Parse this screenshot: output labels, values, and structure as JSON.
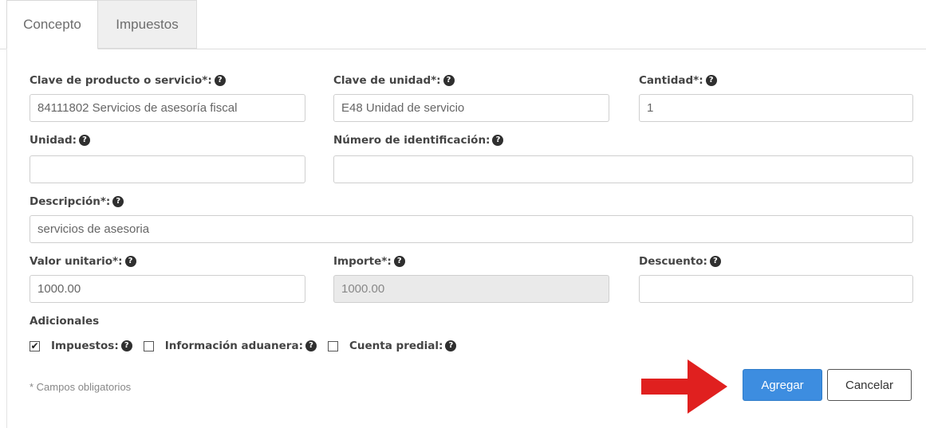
{
  "tabs": [
    {
      "label": "Concepto",
      "active": true
    },
    {
      "label": "Impuestos",
      "active": false
    }
  ],
  "fields": {
    "clave_producto": {
      "label": "Clave de producto o servicio*:",
      "value": "84111802 Servicios de asesoría fiscal"
    },
    "clave_unidad": {
      "label": "Clave de unidad*:",
      "value": "E48 Unidad de servicio"
    },
    "cantidad": {
      "label": "Cantidad*:",
      "value": "1"
    },
    "unidad": {
      "label": "Unidad:",
      "value": ""
    },
    "numero_identificacion": {
      "label": "Número de identificación:",
      "value": ""
    },
    "descripcion": {
      "label": "Descripción*:",
      "value": "servicios de asesoria"
    },
    "valor_unitario": {
      "label": "Valor unitario*:",
      "value": "1000.00"
    },
    "importe": {
      "label": "Importe*:",
      "value": "1000.00"
    },
    "descuento": {
      "label": "Descuento:",
      "value": ""
    }
  },
  "adicionales": {
    "title": "Adicionales",
    "options": [
      {
        "label": "Impuestos:",
        "checked": true
      },
      {
        "label": "Información aduanera:",
        "checked": false
      },
      {
        "label": "Cuenta predial:",
        "checked": false
      }
    ]
  },
  "note": "* Campos obligatorios",
  "buttons": {
    "agregar": "Agregar",
    "cancelar": "Cancelar"
  },
  "icons": {
    "help": "question-circle-icon",
    "check": "✔",
    "arrow": "red-arrow-right-icon"
  },
  "colors": {
    "primary": "#3d8de0",
    "arrow": "#e0201f"
  }
}
